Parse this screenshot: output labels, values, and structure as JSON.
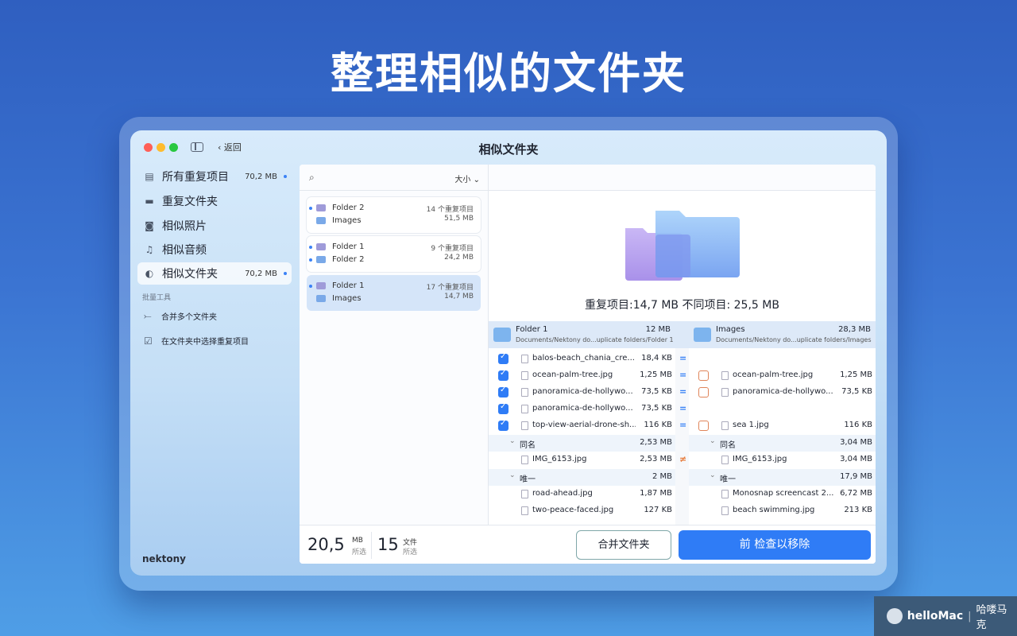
{
  "headline": "整理相似的文件夹",
  "window": {
    "title": "相似文件夹",
    "back_label": "返回"
  },
  "sidebar": {
    "items": [
      {
        "label": "所有重复项目",
        "size": "70,2 MB",
        "icon": "document-icon"
      },
      {
        "label": "重复文件夹",
        "size": "",
        "icon": "folder-icon"
      },
      {
        "label": "相似照片",
        "size": "",
        "icon": "camera-icon"
      },
      {
        "label": "相似音频",
        "size": "",
        "icon": "music-note-icon"
      },
      {
        "label": "相似文件夹",
        "size": "70,2 MB",
        "icon": "similar-folders-icon",
        "selected": true
      }
    ],
    "section_label": "批量工具",
    "tools": [
      {
        "label": "合并多个文件夹",
        "icon": "merge-icon"
      },
      {
        "label": "在文件夹中选择重复项目",
        "icon": "checkbox-folder-icon"
      }
    ],
    "brand": "nektony"
  },
  "pairs_panel": {
    "sort_label": "大小",
    "pairs": [
      {
        "a": "Folder 2",
        "b": "Images",
        "count": "14 个重复项目",
        "size": "51,5 MB"
      },
      {
        "a": "Folder 1",
        "b": "Folder 2",
        "count": "9 个重复项目",
        "size": "24,2 MB"
      },
      {
        "a": "Folder 1",
        "b": "Images",
        "count": "17 个重复项目",
        "size": "14,7 MB",
        "selected": true
      }
    ]
  },
  "detail": {
    "summary": "重复项目:14,7 MB 不同项目: 25,5 MB",
    "left": {
      "name": "Folder 1",
      "size": "12 MB",
      "path": "Documents/Nektony do...uplicate folders/Folder 1"
    },
    "right": {
      "name": "Images",
      "size": "28,3 MB",
      "path": "Documents/Nektony do...uplicate folders/Images"
    },
    "rows": [
      {
        "left": {
          "name": "balos-beach_chania_cre...",
          "size": "18,4 KB"
        },
        "mark": "=",
        "right": null
      },
      {
        "left": {
          "name": "ocean-palm-tree.jpg",
          "size": "1,25 MB"
        },
        "mark": "=",
        "right": {
          "name": "ocean-palm-tree.jpg",
          "size": "1,25 MB"
        }
      },
      {
        "left": {
          "name": "panoramica-de-hollywo...",
          "size": "73,5 KB"
        },
        "mark": "=",
        "right": {
          "name": "panoramica-de-hollywo...",
          "size": "73,5 KB"
        }
      },
      {
        "left": {
          "name": "panoramica-de-hollywo...",
          "size": "73,5 KB"
        },
        "mark": "=",
        "right": null
      },
      {
        "left": {
          "name": "top-view-aerial-drone-sh...",
          "size": "116 KB"
        },
        "mark": "=",
        "right": {
          "name": "sea 1.jpg",
          "size": "116 KB"
        }
      }
    ],
    "group_same": {
      "label": "同名",
      "left_size": "2,53 MB",
      "right_size": "3,04 MB"
    },
    "same_row": {
      "left": {
        "name": "IMG_6153.jpg",
        "size": "2,53 MB"
      },
      "mark": "≠",
      "right": {
        "name": "IMG_6153.jpg",
        "size": "3,04 MB"
      }
    },
    "group_unique": {
      "label": "唯一",
      "left_size": "2 MB",
      "right_size": "17,9 MB"
    },
    "unique_rows": [
      {
        "left": {
          "name": "road-ahead.jpg",
          "size": "1,87 MB"
        },
        "right": {
          "name": "Monosnap screencast 2...",
          "size": "6,72 MB"
        }
      },
      {
        "left": {
          "name": "two-peace-faced.jpg",
          "size": "127 KB"
        },
        "right": {
          "name": "beach swimming.jpg",
          "size": "213 KB"
        }
      }
    ]
  },
  "footer": {
    "selected_size": "20,5",
    "size_unit": "MB",
    "size_caption": "所选",
    "selected_files": "15",
    "files_unit": "文件",
    "files_caption": "所选",
    "merge_button": "合并文件夹",
    "review_button": "前 检查以移除"
  },
  "watermark": {
    "brand": "helloMac",
    "text": "哈喽马克"
  },
  "colors": {
    "accent": "#2f7cf6",
    "selected_pair": "#d5e5f9",
    "not_equal": "#e77b3a"
  }
}
